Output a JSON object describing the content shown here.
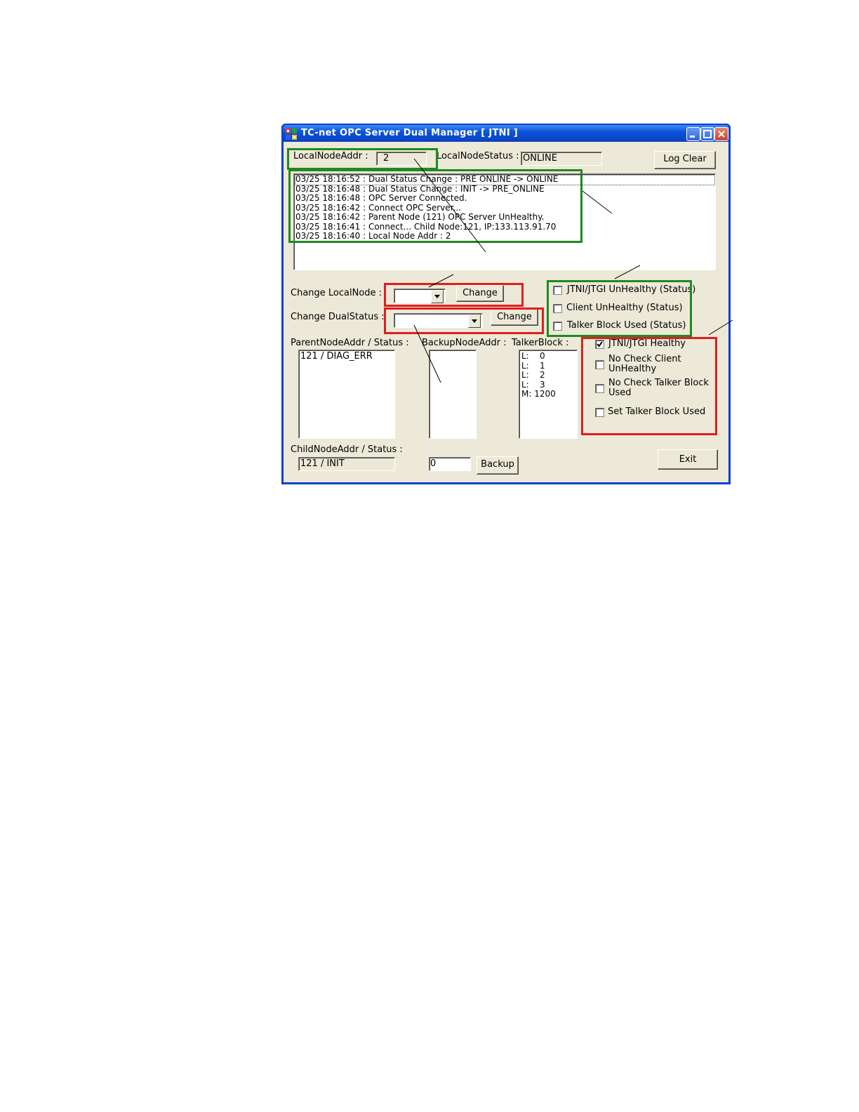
{
  "window": {
    "title": "TC-net OPC Server Dual Manager [ JTNI ]"
  },
  "top": {
    "local_node_addr_label": "LocalNodeAddr :",
    "local_node_addr_value": "2",
    "local_node_status_label": "LocalNodeStatus :",
    "local_node_status_value": "ONLINE",
    "log_clear_label": "Log Clear"
  },
  "log": {
    "lines": [
      "03/25 18:16:52 : Dual Status Change : PRE ONLINE -> ONLINE",
      "03/25 18:16:48 : Dual Status Change : INIT -> PRE_ONLINE",
      "03/25 18:16:48 : OPC Server Connected.",
      "03/25 18:16:42 : Connect OPC Server...",
      "03/25 18:16:42 : Parent Node (121) OPC Server UnHealthy.",
      "03/25 18:16:41 : Connect... Child Node:121, IP:133.113.91.70",
      "03/25 18:16:40 : Local Node Addr :   2"
    ]
  },
  "change": {
    "local_node_label": "Change LocalNode :",
    "dual_status_label": "Change DualStatus :",
    "change_button_label": "Change"
  },
  "status_checks": [
    {
      "label": "JTNI/JTGI UnHealthy (Status)",
      "checked": false
    },
    {
      "label": "Client UnHealthy (Status)",
      "checked": false
    },
    {
      "label": "Talker Block Used (Status)",
      "checked": false
    }
  ],
  "setting_checks": [
    {
      "label": "JTNI/JTGI Healthy",
      "label2": "",
      "checked": true
    },
    {
      "label": "No Check Client",
      "label2": "UnHealthy",
      "checked": false
    },
    {
      "label": "No Check Talker Block",
      "label2": "Used",
      "checked": false
    },
    {
      "label": "Set Talker Block Used",
      "label2": "",
      "checked": false
    }
  ],
  "lists": {
    "parent_label": "ParentNodeAddr / Status :",
    "parent_items": [
      "121 / DIAG_ERR"
    ],
    "backup_label": "BackupNodeAddr :",
    "talker_label": "TalkerBlock :",
    "talker_items": [
      "L:    0",
      "L:    1",
      "L:    2",
      "L:    3",
      "M: 1200"
    ]
  },
  "bottom": {
    "child_label": "ChildNodeAddr / Status :",
    "child_value": "121 / INIT",
    "backup_input_value": "0",
    "backup_button_label": "Backup",
    "exit_button_label": "Exit"
  },
  "colors": {
    "annotation_green": "#1f8a1f",
    "annotation_red": "#e01e1e",
    "titlebar_blue": "#0a46c8",
    "window_face": "#ece9d8"
  },
  "icons": [
    "app-icon",
    "minimize-icon",
    "maximize-icon",
    "close-icon",
    "dropdown-arrow-icon",
    "checkmark-icon"
  ]
}
